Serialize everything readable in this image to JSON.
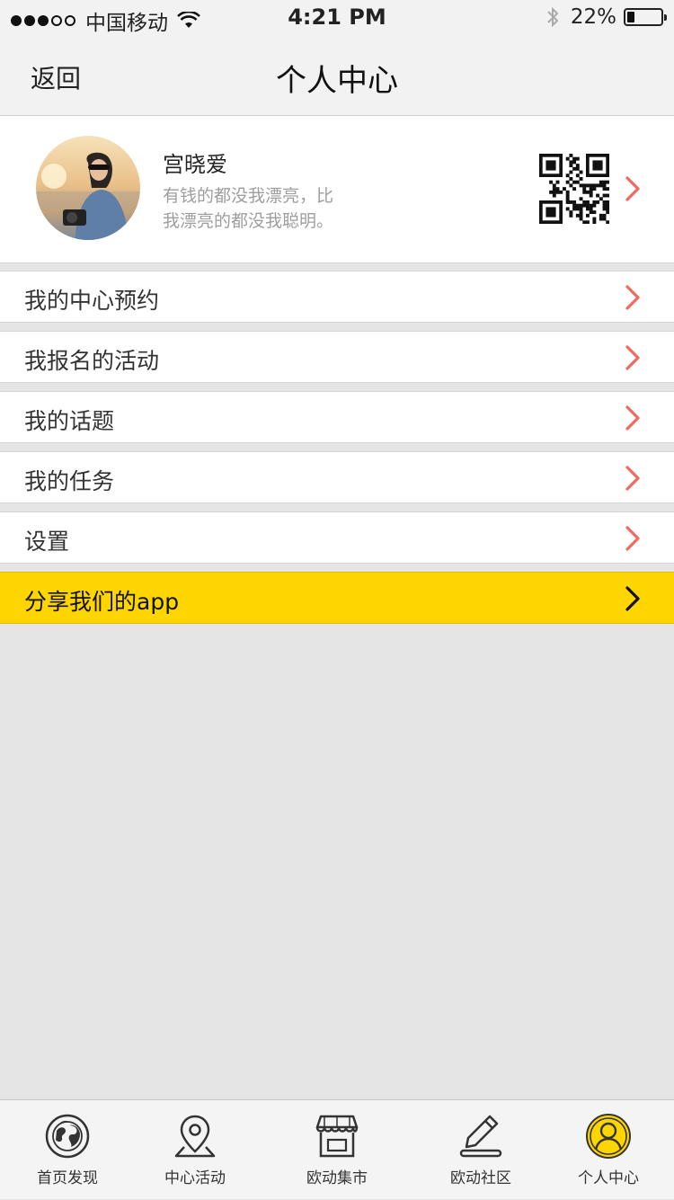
{
  "status_bar": {
    "carrier": "中国移动",
    "time": "4:21 PM",
    "battery": "22%",
    "battery_level": 0.22
  },
  "nav": {
    "back_label": "返回",
    "title": "个人中心"
  },
  "profile": {
    "name": "宫晓爱",
    "motto_line1": "有钱的都没我漂亮，比",
    "motto_line2": "我漂亮的都没我聪明。"
  },
  "menu": {
    "items": [
      {
        "label": "我的中心预约",
        "icon": "chevron-right-icon"
      },
      {
        "label": "我报名的活动",
        "icon": "chevron-right-icon"
      },
      {
        "label": "我的话题",
        "icon": "chevron-right-icon"
      },
      {
        "label": "我的任务",
        "icon": "chevron-right-icon"
      },
      {
        "label": "设置",
        "icon": "chevron-right-icon"
      }
    ],
    "share_label": "分享我们的app"
  },
  "tabbar": {
    "items": [
      {
        "label": "首页发现",
        "icon": "globe-icon",
        "active": false
      },
      {
        "label": "中心活动",
        "icon": "location-pin-icon",
        "active": false
      },
      {
        "label": "欧动集市",
        "icon": "store-icon",
        "active": false
      },
      {
        "label": "欧动社区",
        "icon": "pencil-icon",
        "active": false
      },
      {
        "label": "个人中心",
        "icon": "user-icon",
        "active": true
      }
    ]
  },
  "colors": {
    "accent_yellow": "#FFD500",
    "arrow_red": "#F06A5F",
    "background": "#E5E5E5"
  }
}
